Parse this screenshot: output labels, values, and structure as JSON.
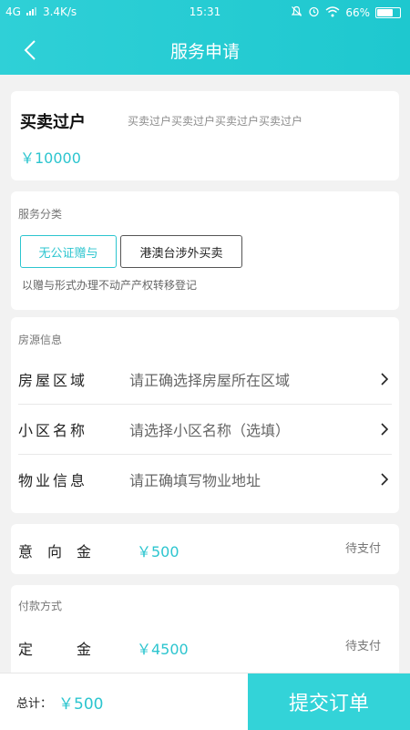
{
  "status_bar": {
    "network": "4G",
    "speed": "3.4K/s",
    "time": "15:31",
    "battery": "66%"
  },
  "header": {
    "title": "服务申请"
  },
  "service": {
    "name": "买卖过户",
    "description": "买卖过户买卖过户买卖过户买卖过户",
    "price": "￥10000"
  },
  "category": {
    "title": "服务分类",
    "options": [
      {
        "label": "无公证赠与",
        "selected": true
      },
      {
        "label": "港澳台涉外买卖",
        "selected": false
      }
    ],
    "note": "以赠与形式办理不动产产权转移登记"
  },
  "property": {
    "title": "房源信息",
    "rows": [
      {
        "label": "房屋区域",
        "value": "请正确选择房屋所在区域"
      },
      {
        "label": "小区名称",
        "value": "请选择小区名称（选填）"
      },
      {
        "label": "物业信息",
        "value": "请正确填写物业地址"
      }
    ]
  },
  "intent": {
    "label": "意　向　金",
    "value": "￥500",
    "status": "待支付"
  },
  "payment": {
    "title": "付款方式",
    "deposit_label": "定　　　金",
    "deposit_value": "￥4500",
    "deposit_status": "待支付"
  },
  "footer": {
    "total_label": "总计：",
    "total_value": "￥500",
    "submit_label": "提交订单"
  },
  "colors": {
    "accent": "#2cc5cf",
    "header": "#1ec8cf",
    "submit": "#33d3d8"
  }
}
